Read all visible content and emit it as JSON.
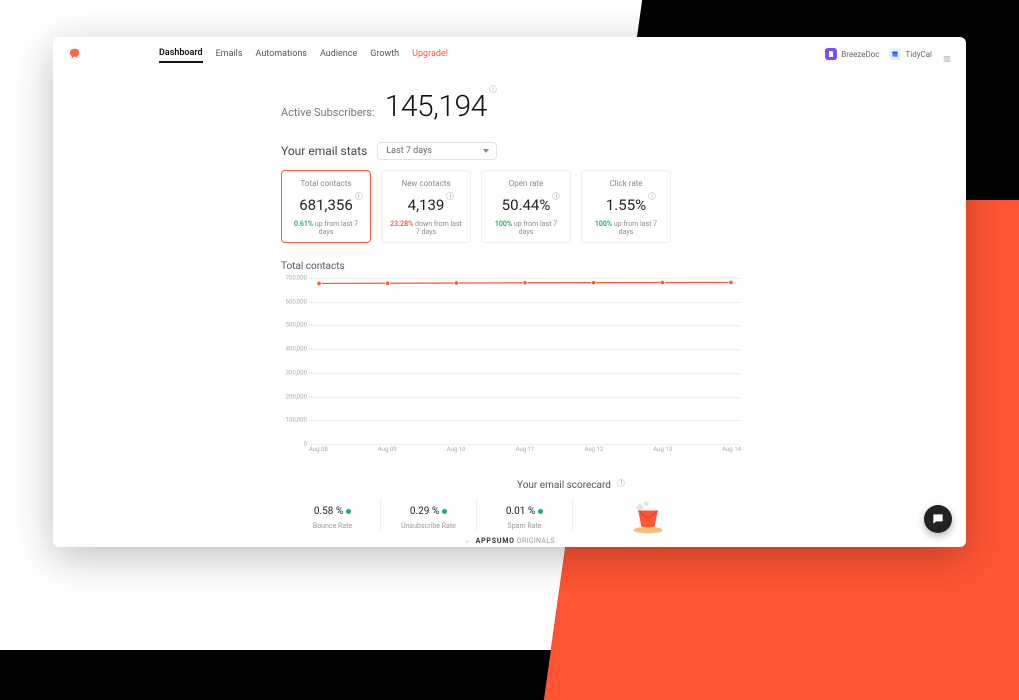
{
  "nav": {
    "items": [
      {
        "label": "Dashboard",
        "active": true
      },
      {
        "label": "Emails"
      },
      {
        "label": "Automations"
      },
      {
        "label": "Audience"
      },
      {
        "label": "Growth"
      },
      {
        "label": "Upgrade!",
        "upgrade": true
      }
    ]
  },
  "topbar_right": {
    "item1": "BreezeDoc",
    "item2": "TidyCal"
  },
  "active_subscribers": {
    "label": "Active Subscribers:",
    "value": "145,194"
  },
  "email_stats": {
    "title": "Your email stats",
    "range": "Last 7 days",
    "cards": [
      {
        "label": "Total contacts",
        "value": "681,356",
        "pct": "0.61%",
        "dir": "up",
        "suffix": "up from last 7 days",
        "highlight": true
      },
      {
        "label": "New contacts",
        "value": "4,139",
        "pct": "23.28%",
        "dir": "down",
        "suffix": "down from last 7 days"
      },
      {
        "label": "Open rate",
        "value": "50.44%",
        "pct": "100%",
        "dir": "up",
        "suffix": "up from last 7 days"
      },
      {
        "label": "Click rate",
        "value": "1.55%",
        "pct": "100%",
        "dir": "up",
        "suffix": "up from last 7 days"
      }
    ]
  },
  "chart_data": {
    "type": "line",
    "title": "Total contacts",
    "ylabel": "",
    "xlabel": "",
    "ylim": [
      0,
      700000
    ],
    "y_ticks": [
      "700,000",
      "600,000",
      "500,000",
      "400,000",
      "300,000",
      "200,000",
      "100,000",
      "0"
    ],
    "categories": [
      "Aug 08",
      "Aug 09",
      "Aug 10",
      "Aug 11",
      "Aug 12",
      "Aug 13",
      "Aug 14"
    ],
    "series": [
      {
        "name": "Total contacts",
        "color": "#ff5532",
        "values": [
          677000,
          678000,
          679000,
          680000,
          680500,
          681000,
          681356
        ]
      }
    ]
  },
  "scorecard": {
    "title": "Your email scorecard",
    "items": [
      {
        "value": "0.58 %",
        "label": "Bounce Rate"
      },
      {
        "value": "0.29 %",
        "label": "Unsubscribe Rate"
      },
      {
        "value": "0.01 %",
        "label": "Spam Rate"
      }
    ]
  },
  "footer": {
    "brand": "APPSUMO",
    "suffix": "ORIGINALS",
    "arrow": "←"
  }
}
